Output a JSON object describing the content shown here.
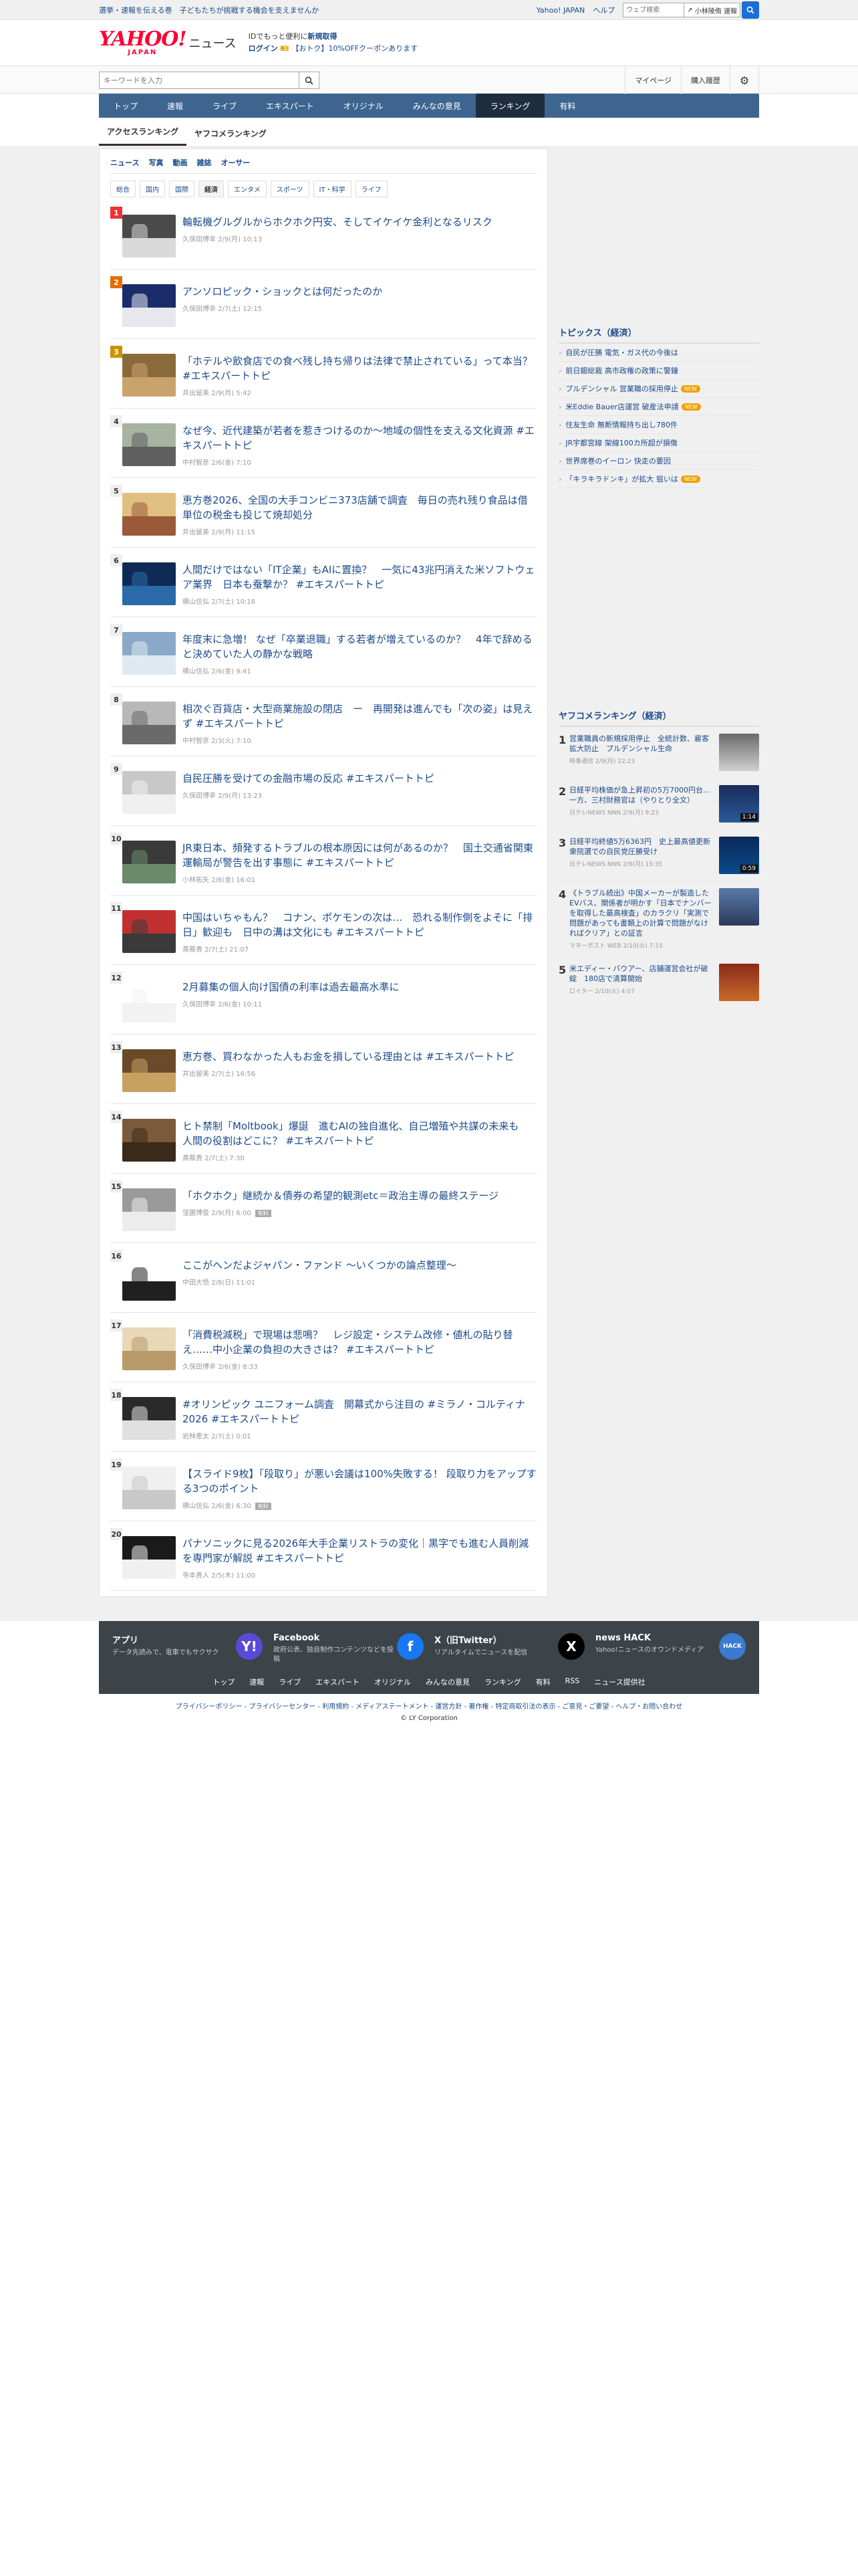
{
  "topbar": {
    "message": "選挙・速報を伝える巻　子どもたちが挑戦する機会を支えませんか",
    "links": [
      "Yahoo! JAPAN",
      "ヘルプ"
    ],
    "web_search_placeholder": "ウェブ検索",
    "autocomplete": "小林陵侑 速報"
  },
  "header": {
    "logo": "YAHOO!",
    "logo_sub": "JAPAN",
    "section": "ニュース",
    "promo_line1": "IDでもっと便利に",
    "promo_line1_em": "新規取得",
    "login": "ログイン",
    "coupon": "【おトク】10%OFFクーポンあります"
  },
  "search": {
    "placeholder": "キーワードを入力",
    "mypage": "マイページ",
    "history": "購入履歴"
  },
  "gnav": [
    "トップ",
    "速報",
    "ライブ",
    "エキスパート",
    "オリジナル",
    "みんなの意見",
    "ランキング",
    "有料"
  ],
  "gnav_active": "ランキング",
  "subtabs": [
    "アクセスランキング",
    "ヤフコメランキング"
  ],
  "cat1": [
    "ニュース",
    "写真",
    "動画",
    "雑誌",
    "オーサー"
  ],
  "cat2": [
    "総合",
    "国内",
    "国際",
    "経済",
    "エンタメ",
    "スポーツ",
    "IT・科学",
    "ライフ"
  ],
  "cat2_active": "経済",
  "ranking": [
    {
      "rank": "1",
      "title": "輪転機グルグルからホクホク円安、そしてイケイケ金利となるリスク",
      "source": "久保田博幸",
      "time": "2/9(月) 10:13",
      "c1": "#4a4a4a",
      "c2": "#d9d9d9"
    },
    {
      "rank": "2",
      "title": "アンソロピック・ショックとは何だったのか",
      "source": "久保田博幸",
      "time": "2/7(土) 12:15",
      "c1": "#1b2c6b",
      "c2": "#e7e7ee"
    },
    {
      "rank": "3",
      "title": "「ホテルや飲食店での食べ残し持ち帰りは法律で禁止されている」って本当？ #エキスパートトピ",
      "source": "井出留美",
      "time": "2/9(月) 5:42",
      "c1": "#8a6a3a",
      "c2": "#c9a36b"
    },
    {
      "rank": "4",
      "title": "なぜ今、近代建築が若者を惹きつけるのか〜地域の個性を支える文化資源 #エキスパートトピ",
      "source": "中村智彦",
      "time": "2/6(金) 7:10",
      "c1": "#a6b4a0",
      "c2": "#5f5f5f"
    },
    {
      "rank": "5",
      "title": "恵方巻2026、全国の大手コンビニ373店舗で調査　毎日の売れ残り食品は借単位の税金も投じて焼却処分",
      "source": "井出留美",
      "time": "2/9(月) 11:15",
      "c1": "#e0c080",
      "c2": "#9a5a3a"
    },
    {
      "rank": "6",
      "title": "人間だけではない「IT企業」もAIに置換？　一気に43兆円消えた米ソフトウェア業界　日本も蚕撃か？ #エキスパートトピ",
      "source": "横山信弘",
      "time": "2/7(土) 10:16",
      "c1": "#0e2a55",
      "c2": "#2a6aa8"
    },
    {
      "rank": "7",
      "title": "年度末に急増！ なぜ「卒業退職」する若者が増えているのか？　4年で辞めると決めていた人の静かな戦略",
      "source": "横山信弘",
      "time": "2/6(金) 9:41",
      "c1": "#8aa8c8",
      "c2": "#dfe9f2"
    },
    {
      "rank": "8",
      "title": "相次ぐ百貨店・大型商業施設の閉店　ー　再開発は進んでも「次の姿」は見えず #エキスパートトピ",
      "source": "中村智彦",
      "time": "2/3(火) 7:10",
      "c1": "#b8b8b8",
      "c2": "#6a6a6a"
    },
    {
      "rank": "9",
      "title": "自民圧勝を受けての金融市場の反応 #エキスパートトピ",
      "source": "久保田博幸",
      "time": "2/9(月) 13:23",
      "c1": "#c8c8c8",
      "c2": "#f0f0f0"
    },
    {
      "rank": "10",
      "title": "JR東日本、頻発するトラブルの根本原因には何があるのか？　国土交通省関東運輸局が警告を出す事態に #エキスパートトピ",
      "source": "小林拓矢",
      "time": "2/6(金) 16:01",
      "c1": "#3a3a3a",
      "c2": "#6a8a6a"
    },
    {
      "rank": "11",
      "title": "中国はいちゃもん？　コナン、ポケモンの次は…　恐れる制作側をよそに「排日」歓迎も　日中の溝は文化にも #エキスパートトピ",
      "source": "斎藤貴",
      "time": "2/7(土) 21:07",
      "c1": "#c03030",
      "c2": "#3a3a3a"
    },
    {
      "rank": "12",
      "title": "2月募集の個人向け国債の利率は過去最高水準に",
      "source": "久保田博幸",
      "time": "2/6(金) 10:11",
      "c1": "#ffffff",
      "c2": "#f2f2f2"
    },
    {
      "rank": "13",
      "title": "恵方巻、買わなかった人もお金を損している理由とは #エキスパートトピ",
      "source": "井出留美",
      "time": "2/7(土) 16:56",
      "c1": "#6a4a2a",
      "c2": "#c8a060"
    },
    {
      "rank": "14",
      "title": "ヒト禁制「Moltbook」爆誕　進むAIの独自進化、自己増殖や共謀の未来も　人間の役割はどこに？ #エキスパートトピ",
      "source": "斎藤貴",
      "time": "2/7(土) 7:30",
      "c1": "#7a5a3a",
      "c2": "#3a2a1a"
    },
    {
      "rank": "15",
      "title": "「ホクホク」継続か＆債券の希望的観測etc＝政治主導の最終ステージ",
      "source": "窪園博俊",
      "time": "2/9(月) 6:00",
      "tag": "有料",
      "c1": "#9a9a9a",
      "c2": "#ececec"
    },
    {
      "rank": "16",
      "title": "ここがへンだよジャパン・ファンド 〜いくつかの論点整理〜",
      "source": "中田大悟",
      "time": "2/8(日) 11:01",
      "c1": "#ffffff",
      "c2": "#202020"
    },
    {
      "rank": "17",
      "title": "「消費税減税」で現場は悲鳴？　レジ設定・システム改修・値札の貼り替え……中小企業の負担の大きさは？ #エキスパートトピ",
      "source": "久保田博幸",
      "time": "2/6(金) 8:33",
      "c1": "#e8d8b8",
      "c2": "#b89a6a"
    },
    {
      "rank": "18",
      "title": "#オリンピック ユニフォーム調査　開幕式から注目の #ミラノ・コルティナ2026 #エキスパートトピ",
      "source": "岩林恵太",
      "time": "2/7(土) 0:01",
      "c1": "#2a2a2a",
      "c2": "#e0e0e0"
    },
    {
      "rank": "19",
      "title": "【スライド9枚】「段取り」が悪い会議は100%失敗する！ 段取り力をアップする3つのポイント",
      "source": "横山信弘",
      "time": "2/6(金) 6:30",
      "tag": "有料",
      "c1": "#f0f0f0",
      "c2": "#c8c8c8"
    },
    {
      "rank": "20",
      "title": "パナソニックに見る2026年大手企業リストラの変化｜黒字でも進む人員削減を専門家が解説 #エキスパートトピ",
      "source": "寺本貴人",
      "time": "2/5(木) 11:00",
      "c1": "#1a1a1a",
      "c2": "#f0f0f0"
    }
  ],
  "topics": {
    "title": "トピックス（経済）",
    "items": [
      {
        "text": "自民が圧勝 電気・ガス代の今後は",
        "new": false
      },
      {
        "text": "前日銀総裁 高市政権の政策に警鐘",
        "new": false
      },
      {
        "text": "プルデンシャル 営業職の採用停止",
        "new": true
      },
      {
        "text": "米Eddie Bauer店運営 破産法申請",
        "new": true
      },
      {
        "text": "住友生命 無断情報持ち出し780件",
        "new": false
      },
      {
        "text": "JR宇都宮線 架線100カ所超が損傷",
        "new": false
      },
      {
        "text": "世界席巻のイーロン 快走の要因",
        "new": false
      },
      {
        "text": "「キラキラドンキ」が拡大 狙いは",
        "new": true
      }
    ],
    "new_label": "NEW"
  },
  "yafuko": {
    "title": "ヤフコメランキング（経済）",
    "items": [
      {
        "rank": "1",
        "title": "営業職員の新規採用停止　全統計数、雇客拡大防止　プルデンシャル生命",
        "source": "時事通信",
        "time": "2/9(月) 22:23",
        "overlay": "",
        "c1": "#6a6a6a",
        "c2": "#d0d0d0"
      },
      {
        "rank": "2",
        "title": "日経平均株価が急上昇初の5万7000円台…一方、三村財務官は（やりとり全文）",
        "source": "日テレNEWS NNN",
        "time": "2/9(月) 9:23",
        "overlay": "1:14",
        "c1": "#1a2a5a",
        "c2": "#2a5a9a"
      },
      {
        "rank": "3",
        "title": "日経平均終値5万6363円　史上最高値更新　衆院選での自民党圧勝受け",
        "source": "日テレNEWS NNN",
        "time": "2/9(月) 15:35",
        "overlay": "0:59",
        "c1": "#0a2a5a",
        "c2": "#0a4a8a"
      },
      {
        "rank": "4",
        "title": "《トラブル続出》中国メーカーが製造したEVバス、関係者が明かす「日本でナンバーを取得した最高検査」のカラクリ「実測で問題があっても書類上の計算で問題がなければクリア」との証言",
        "source": "マネーポスト WEB",
        "time": "2/10(火) 7:15",
        "overlay": "",
        "c1": "#5a7aaa",
        "c2": "#2a3a5a"
      },
      {
        "rank": "5",
        "title": "米エディー・バウアー、店舗運営会社が破綻　180店で清算開始",
        "source": "ロイター",
        "time": "2/10(火) 4:07",
        "overlay": "",
        "c1": "#8a2a1a",
        "c2": "#c86a2a"
      }
    ]
  },
  "footer": {
    "apps": [
      {
        "name": "アプリ",
        "desc": "データ先読みで、電車でもサクサク",
        "icon": "Y!",
        "color": "#5a4bd6"
      },
      {
        "name": "Facebook",
        "desc": "政府公表、独自制作コンテンツなどを投稿",
        "icon": "f",
        "color": "#1877f2"
      },
      {
        "name": "X（旧Twitter）",
        "desc": "リアルタイムでニュースを配信",
        "icon": "X",
        "color": "#000000"
      },
      {
        "name": "news HACK",
        "desc": "Yahoo!ニュースのオウンドメディア",
        "icon": "HACK",
        "color": "#3a7ad0"
      }
    ],
    "nav": [
      "トップ",
      "速報",
      "ライブ",
      "エキスパート",
      "オリジナル",
      "みんなの意見",
      "ランキング",
      "有料",
      "RSS",
      "ニュース提供社"
    ],
    "legal": "プライバシーポリシー - プライバシーセンター - 利用規約 - メディアステートメント - 運営方針 - 著作権 - 特定商取引法の表示 - ご意見・ご要望 - ヘルプ・お問い合わせ",
    "copyright": "© LY Corporation"
  }
}
